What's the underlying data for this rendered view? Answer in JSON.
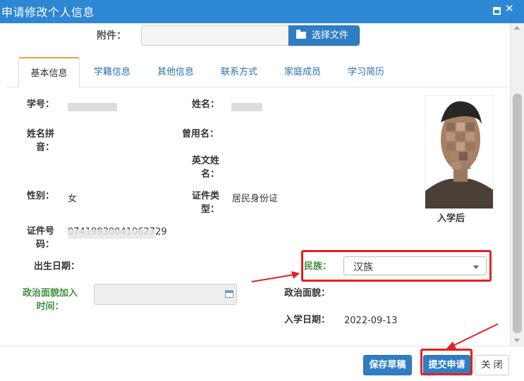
{
  "dialog": {
    "title": "申请修改个人信息"
  },
  "attachment": {
    "label": "附件：",
    "button": "选择文件"
  },
  "tabs": [
    {
      "label": "基本信息"
    },
    {
      "label": "学籍信息"
    },
    {
      "label": "其他信息"
    },
    {
      "label": "联系方式"
    },
    {
      "label": "家庭成员"
    },
    {
      "label": "学习简历"
    }
  ],
  "form": {
    "student_id_label": "学号：",
    "name_label": "姓名：",
    "name_pinyin_label_1": "姓名拼",
    "name_pinyin_label_2": "音：",
    "former_name_label": "曾用名：",
    "english_name_label_1": "英文姓",
    "english_name_label_2": "名：",
    "gender_label": "性别：",
    "gender_value": "女",
    "id_type_label_1": "证件类",
    "id_type_label_2": "型：",
    "id_type_value": "居民身份证",
    "id_number_label_1": "证件号",
    "id_number_label_2": "码：",
    "id_number_value": "07419930041062729",
    "birth_date_label": "出生日期：",
    "ethnicity_label": "民族：",
    "ethnicity_value": "汉族",
    "political_join_label_1": "政治面貌加入",
    "political_join_label_2": "时间：",
    "political_status_label": "政治面貌：",
    "enroll_date_label": "入学日期：",
    "enroll_date_value": "2022-09-13"
  },
  "photo": {
    "caption": "入学后"
  },
  "footer": {
    "save_draft": "保存草稿",
    "submit": "提交申请",
    "close": "关 闭"
  },
  "colors": {
    "titlebar": "#2d87d4",
    "primary_button": "#2f7ec4",
    "highlight_red": "#e52020",
    "label_green": "#3f8f3f"
  }
}
